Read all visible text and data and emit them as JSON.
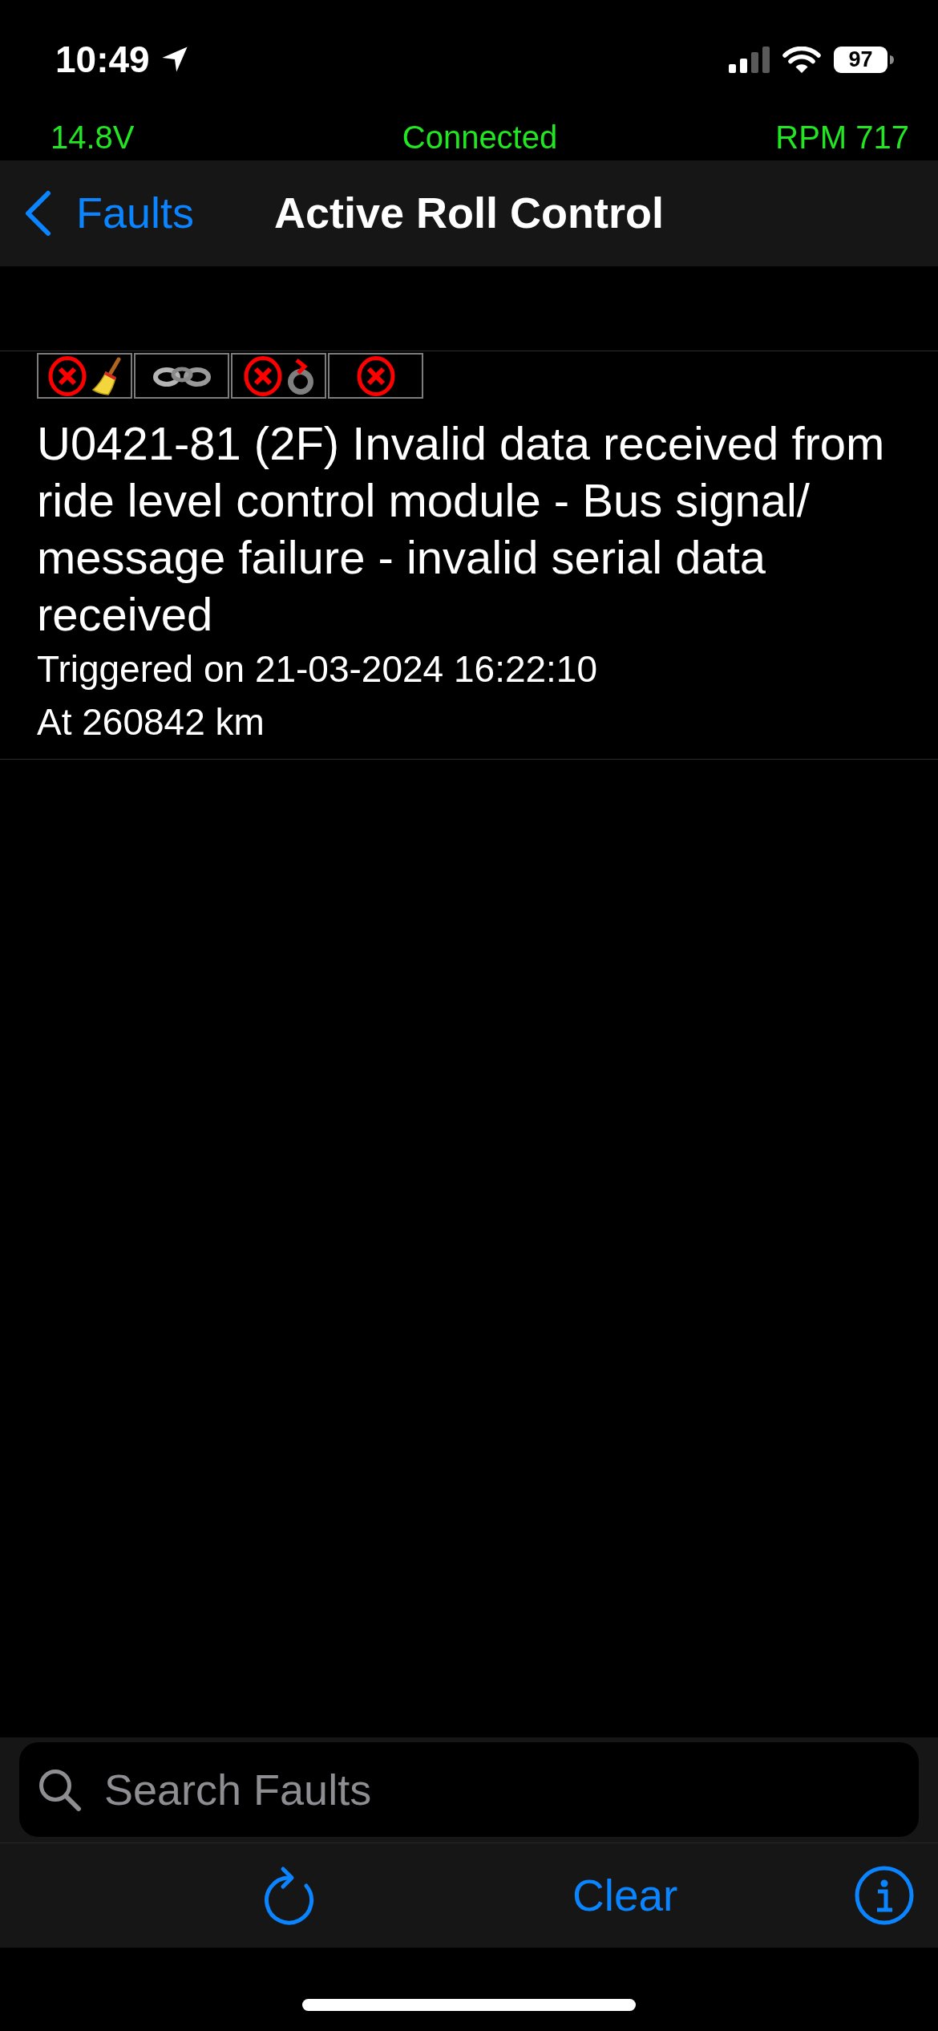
{
  "status_bar": {
    "time": "10:49",
    "battery": "97"
  },
  "connection_bar": {
    "voltage": "14.8V",
    "status": "Connected",
    "rpm": "RPM 717"
  },
  "nav_bar": {
    "back_label": "Faults",
    "title": "Active Roll Control"
  },
  "faults": [
    {
      "indicators": [
        {
          "icons": [
            {
              "kind": "cross"
            },
            {
              "kind": "broom"
            }
          ]
        },
        {
          "icons": [
            {
              "kind": "chain"
            }
          ]
        },
        {
          "icons": [
            {
              "kind": "cross"
            },
            {
              "kind": "cycle"
            }
          ]
        },
        {
          "icons": [
            {
              "kind": "cross"
            }
          ]
        }
      ],
      "description": "U0421-81 (2F) Invalid data received from ride level control module - Bus signal/message failure - invalid serial data received",
      "triggered": "Triggered on 21-03-2024 16:22:10",
      "odometer": "At 260842 km"
    }
  ],
  "search": {
    "placeholder": "Search Faults"
  },
  "toolbar": {
    "clear_label": "Clear"
  }
}
